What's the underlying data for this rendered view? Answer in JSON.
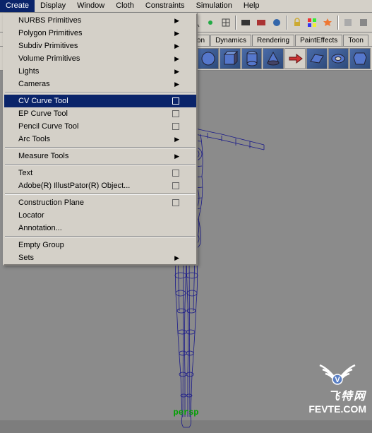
{
  "menubar": {
    "items": [
      "Create",
      "Display",
      "Window",
      "Cloth",
      "Constraints",
      "Simulation",
      "Help"
    ],
    "active_index": 0
  },
  "tabbar": {
    "visible_tabs": [
      "ion",
      "Dynamics",
      "Rendering",
      "PaintEffects",
      "Toon"
    ]
  },
  "dropdown": {
    "sections": [
      [
        {
          "label": "NURBS Primitives",
          "submenu": true
        },
        {
          "label": "Polygon Primitives",
          "submenu": true
        },
        {
          "label": "Subdiv Primitives",
          "submenu": true
        },
        {
          "label": "Volume Primitives",
          "submenu": true
        },
        {
          "label": "Lights",
          "submenu": true
        },
        {
          "label": "Cameras",
          "submenu": true
        }
      ],
      [
        {
          "label": "CV Curve Tool",
          "option": true,
          "selected": true
        },
        {
          "label": "EP Curve Tool",
          "option": true
        },
        {
          "label": "Pencil Curve Tool",
          "option": true
        },
        {
          "label": "Arc Tools",
          "submenu": true
        }
      ],
      [
        {
          "label": "Measure Tools",
          "submenu": true
        }
      ],
      [
        {
          "label": "Text",
          "option": true
        },
        {
          "label": "Adobe(R) IllustPator(R) Object...",
          "option": true
        }
      ],
      [
        {
          "label": "Construction Plane",
          "option": true
        },
        {
          "label": "Locator"
        },
        {
          "label": "Annotation..."
        }
      ],
      [
        {
          "label": "Empty Group"
        },
        {
          "label": "Sets",
          "submenu": true
        }
      ]
    ]
  },
  "viewport": {
    "camera_label": "persp"
  },
  "watermark": {
    "line1": "飞特网",
    "line2": "FEVTE.COM"
  },
  "toolbar_icons": [
    "new",
    "open",
    "save",
    "sep",
    "cube",
    "undo",
    "redo",
    "sep",
    "select",
    "lasso",
    "paint",
    "sep",
    "move",
    "rotate",
    "scale",
    "sep",
    "snap-curve",
    "snap-point",
    "snap-grid",
    "sep",
    "render",
    "ipr",
    "render-globe",
    "sep",
    "lock",
    "palette",
    "explode",
    "sep",
    "shelf1",
    "shelf2"
  ],
  "shelf_icons": [
    "sphere",
    "cube",
    "cylinder",
    "cone",
    "plane",
    "torus",
    "prism",
    "pyramid",
    "pipe",
    "helix",
    "soccer",
    "platonic"
  ]
}
